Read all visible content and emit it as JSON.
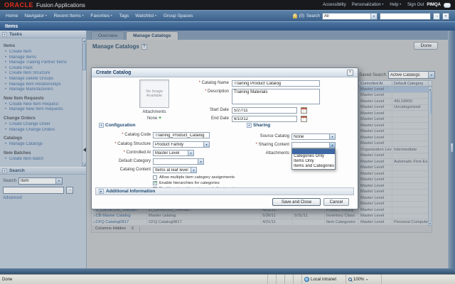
{
  "topbar": {
    "logo": "ORACLE",
    "app_name": "Fusion Applications",
    "links": [
      {
        "label": "Accessibility"
      },
      {
        "label": "Personalization",
        "dropdown": true
      },
      {
        "label": "Help",
        "dropdown": true
      },
      {
        "label": "Sign Out"
      }
    ],
    "user": "PIMQA"
  },
  "navbar": {
    "items": [
      {
        "label": "Home"
      },
      {
        "label": "Navigator",
        "dropdown": true
      },
      {
        "label": "Recent Items",
        "dropdown": true
      },
      {
        "label": "Favorites",
        "dropdown": true
      },
      {
        "label": "Tags"
      },
      {
        "label": "Watchlist",
        "dropdown": true
      },
      {
        "label": "Group Spaces"
      }
    ],
    "alert_count": "(0)",
    "search_label": "Search",
    "search_scope": "All",
    "search_value": ""
  },
  "page_title": "Items",
  "sidebar": {
    "tasks_panel_title": "Tasks",
    "items": [
      {
        "type": "header",
        "label": "Items"
      },
      {
        "type": "link",
        "label": "Create Item"
      },
      {
        "type": "link",
        "label": "Manage Items"
      },
      {
        "type": "link",
        "label": "Manage Trading Partner Items"
      },
      {
        "type": "link",
        "label": "Create Pack"
      },
      {
        "type": "link",
        "label": "Create Item Structure"
      },
      {
        "type": "link",
        "label": "Manage Delete Groups"
      },
      {
        "type": "link",
        "label": "Manage Item Relationships"
      },
      {
        "type": "link",
        "label": "Manage Manufacturers"
      },
      {
        "type": "header",
        "label": "New Item Requests"
      },
      {
        "type": "link",
        "label": "Create New Item Request"
      },
      {
        "type": "link",
        "label": "Manage New Item Requests"
      },
      {
        "type": "header",
        "label": "Change Orders"
      },
      {
        "type": "link",
        "label": "Create Change Order"
      },
      {
        "type": "link",
        "label": "Manage Change Orders"
      },
      {
        "type": "header",
        "label": "Catalogs"
      },
      {
        "type": "link",
        "label": "Manage Catalogs"
      },
      {
        "type": "header",
        "label": "Item Batches"
      },
      {
        "type": "link",
        "label": "Create Item Batch"
      }
    ],
    "search_panel_title": "Search",
    "search_label": "Search",
    "search_scope": "Item",
    "advanced_link": "Advanced"
  },
  "content": {
    "tabs": [
      {
        "label": "Overview"
      },
      {
        "label": "Manage Catalogs",
        "active": true
      }
    ],
    "heading": "Manage Catalogs",
    "help_glyph": "?",
    "done_button": "Done",
    "saved_search_label": "Saved Search",
    "saved_search_value": "Active Catalogs",
    "table": {
      "headers": [
        "",
        "",
        "",
        "",
        "",
        "Controlled At",
        "Default Category"
      ],
      "rows": [
        {
          "ca": "Master Level",
          "selected": true
        },
        {
          "ca": "Master Level"
        },
        {
          "ca": "Master Level",
          "dc": "49L19900"
        },
        {
          "ca": "Master Level",
          "dc": "Uncategorized"
        },
        {
          "ca": "Master Level"
        },
        {
          "ca": "Master Level"
        },
        {
          "ca": "Master Level"
        },
        {
          "ca": "Master Level"
        },
        {
          "ca": "Master Level"
        },
        {
          "ca": "Master Level"
        },
        {
          "ca": "Organization Level",
          "dc": "Intermediate"
        },
        {
          "ca": "Master Level"
        },
        {
          "ca": "Master Level",
          "dc": "Automatic First-Ex..."
        },
        {
          "ca": "Master Level"
        },
        {
          "ca": "Master Level"
        },
        {
          "ca": "Master Level"
        },
        {
          "ca": "Master Level"
        },
        {
          "ca": "Master Level"
        },
        {
          "ca": "Master Level"
        },
        {
          "ca": "Master Level"
        },
        {
          "n": "B_CATALOG_TARGET",
          "d": "B_CATALOG_TARGET",
          "s": "4/21/11",
          "e": "",
          "st": "Product Family",
          "ca": "Master Level",
          "dc": ""
        },
        {
          "n": "CB Master Catalog",
          "d": "Master catalog.",
          "s": "5/26/11",
          "e": "5/31/11",
          "st": "Inventory Class",
          "ca": "Master Level",
          "dc": ""
        },
        {
          "n": "CFQ Catalog0817",
          "d": "CFQ Catalog0817",
          "s": "4/21/11",
          "e": "",
          "st": "Item Categories",
          "ca": "Master Level",
          "dc": "Personal Computers"
        }
      ]
    },
    "columns_hidden_label": "Columns Hidden",
    "columns_hidden_count": "2"
  },
  "dialog": {
    "title": "Create Catalog",
    "image_placeholder": "No Image Available",
    "attachments_label": "Attachments",
    "attachments_value": "None",
    "catalog_name_label": "Catalog Name",
    "catalog_name_value": "Training Product Catalog",
    "description_label": "Description",
    "description_value": "Training Materials",
    "start_date_label": "Start Date",
    "start_date_value": "5/27/11",
    "end_date_label": "End Date",
    "end_date_value": "6/10/12",
    "configuration": {
      "title": "Configuration",
      "catalog_code_label": "Catalog Code",
      "catalog_code_value": "Training_Product_Catalog",
      "catalog_structure_label": "Catalog Structure",
      "catalog_structure_value": "Product Family",
      "controlled_at_label": "Controlled At",
      "controlled_at_value": "Master Level",
      "default_category_label": "Default Category",
      "default_category_value": "",
      "catalog_content_label": "Catalog Content",
      "catalog_content_value": "Items at leaf level",
      "checkboxes": [
        {
          "label": "Allow multiple item category assignments",
          "checked": false
        },
        {
          "label": "Enable hierarchies for categories",
          "checked": true
        },
        {
          "label": "Enable automatic assignment of categories",
          "checked": false
        }
      ]
    },
    "sharing": {
      "title": "Sharing",
      "source_catalog_label": "Source Catalog",
      "source_catalog_value": "None",
      "sharing_content_label": "Sharing Content",
      "sharing_content_value": "",
      "attachments_label": "Attachments",
      "options": [
        "Categories Only",
        "Items Only",
        "Items and Categories"
      ]
    },
    "additional_info_title": "Additional Information",
    "save_button": "Save and Close",
    "cancel_button": "Cancel"
  },
  "statusbar": {
    "status": "Done",
    "zone": "Local intranet",
    "zoom_level": "100%"
  }
}
